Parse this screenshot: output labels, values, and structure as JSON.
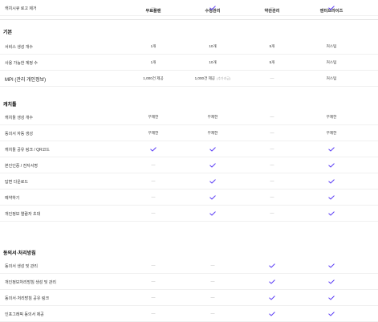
{
  "header": {
    "columns": [
      "무료플랜",
      "수정관리",
      "약관관리",
      "엔터프라이즈"
    ]
  },
  "sections": [
    {
      "title": "기본",
      "rows": [
        {
          "label": "서비스 생성 개수",
          "cells": [
            {
              "t": "1개"
            },
            {
              "t": "10개"
            },
            {
              "t": "5개"
            },
            {
              "t": "커스텀"
            }
          ]
        },
        {
          "label": "사용 가능한 계정 수",
          "cells": [
            {
              "t": "1개"
            },
            {
              "t": "10개"
            },
            {
              "t": "5개"
            },
            {
              "t": "커스텀"
            }
          ]
        },
        {
          "label": "MPI (관리 개인정보)",
          "cells": [
            {
              "t": "1,000건 제공"
            },
            {
              "t": "1,000건 제공",
              "note": "(추가과금)"
            },
            {
              "dash": true
            },
            {
              "t": "커스텀"
            }
          ]
        }
      ]
    },
    {
      "title": "캐치툴",
      "rows": [
        {
          "label": "캐치툴 생성 개수",
          "cells": [
            {
              "t": "무제한"
            },
            {
              "t": "무제한"
            },
            {
              "dash": true
            },
            {
              "t": "무제한"
            }
          ]
        },
        {
          "label": "동의서 자동 생성",
          "cells": [
            {
              "t": "무제한"
            },
            {
              "t": "무제한"
            },
            {
              "dash": true
            },
            {
              "t": "무제한"
            }
          ]
        },
        {
          "label": "캐치툴 공유 링크 / QR코드",
          "cells": [
            {
              "check": true
            },
            {
              "check": true
            },
            {
              "dash": true
            },
            {
              "check": true
            }
          ]
        },
        {
          "label": "본인인증 / 전자서명",
          "cells": [
            {
              "dash": true
            },
            {
              "check": true
            },
            {
              "dash": true
            },
            {
              "check": true
            }
          ]
        },
        {
          "label": "답변 다운로드",
          "cells": [
            {
              "dash": true
            },
            {
              "check": true
            },
            {
              "dash": true
            },
            {
              "check": true
            }
          ]
        },
        {
          "label": "예약하기",
          "cells": [
            {
              "dash": true
            },
            {
              "check": true
            },
            {
              "dash": true
            },
            {
              "check": true
            }
          ]
        },
        {
          "label": "개인정보 열람자 초대",
          "cells": [
            {
              "dash": true
            },
            {
              "check": true
            },
            {
              "dash": true
            },
            {
              "check": true
            }
          ]
        },
        {
          "label": "캐치시큐 로고 제거",
          "cells": [
            {
              "dash": true
            },
            {
              "check": true
            },
            {
              "dash": true
            },
            {
              "check": true
            }
          ]
        }
      ]
    },
    {
      "title": "동의서·처리방침",
      "rows": [
        {
          "label": "동의서 생성 및 관리",
          "cells": [
            {
              "dash": true
            },
            {
              "dash": true
            },
            {
              "check": true
            },
            {
              "check": true
            }
          ]
        },
        {
          "label": "개인정보처리방침 생성 및 관리",
          "cells": [
            {
              "dash": true
            },
            {
              "dash": true
            },
            {
              "check": true
            },
            {
              "check": true
            }
          ]
        },
        {
          "label": "동의서·처리방침 공유 링크",
          "cells": [
            {
              "dash": true
            },
            {
              "dash": true
            },
            {
              "check": true
            },
            {
              "check": true
            }
          ]
        },
        {
          "label": "인포그래픽 동의서 제공",
          "cells": [
            {
              "dash": true
            },
            {
              "dash": true
            },
            {
              "check": true
            },
            {
              "check": true
            }
          ]
        }
      ]
    }
  ],
  "colors": {
    "check": "#5b3df5",
    "dash": "#b0b0b0"
  },
  "icons": {
    "check": "check-icon",
    "dash": "dash-icon"
  }
}
